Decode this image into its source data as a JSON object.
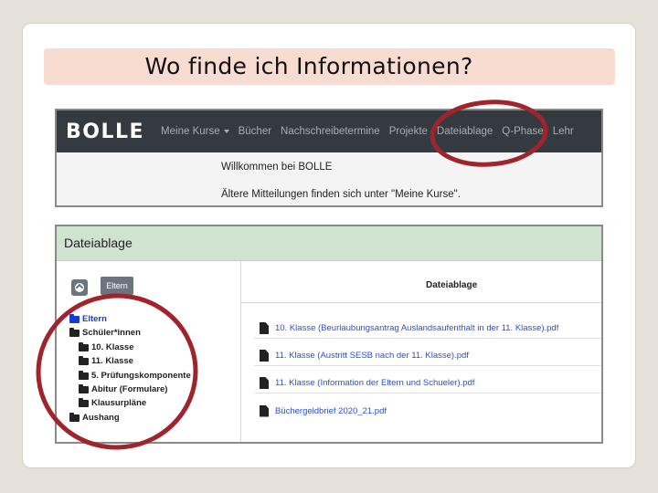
{
  "slide": {
    "title": "Wo finde ich Informationen?"
  },
  "top_screenshot": {
    "logo": "BOLLE",
    "nav_items": [
      {
        "label": "Meine Kurse",
        "dropdown": true
      },
      {
        "label": "Bücher"
      },
      {
        "label": "Nachschreibetermine"
      },
      {
        "label": "Projekte"
      },
      {
        "label": "Dateiablage"
      },
      {
        "label": "Q-Phase"
      },
      {
        "label": "Lehr"
      }
    ],
    "welcome": "Willkommen bei BOLLE",
    "older_messages": "Ältere Mitteilungen finden sich unter \"Meine Kurse\"."
  },
  "bottom_screenshot": {
    "panel_title": "Dateiablage",
    "breadcrumb_button": "Eltern",
    "column_header": "Dateiablage",
    "tree": [
      {
        "label": "Eltern",
        "active": true
      },
      {
        "label": "Schüler*innen"
      },
      {
        "label": "10. Klasse"
      },
      {
        "label": "11. Klasse"
      },
      {
        "label": "5. Prüfungskomponente"
      },
      {
        "label": "Abitur (Formulare)"
      },
      {
        "label": "Klausurpläne"
      },
      {
        "label": "Aushang"
      }
    ],
    "files": [
      "10. Klasse (Beurlaubungsantrag Auslandsaufenthalt in der 11. Klasse).pdf",
      "11. Klasse (Austritt SESB nach der 11. Klasse).pdf",
      "11. Klasse (Information der Eltern und Schueler).pdf",
      "Büchergeldbrief 2020_21.pdf"
    ]
  },
  "colors": {
    "title_band": "#f8dcd1",
    "navbar": "#343a40",
    "panel_header": "#cfe3cf",
    "annotation_circle": "#a0242c",
    "link": "#2a4fd8"
  }
}
